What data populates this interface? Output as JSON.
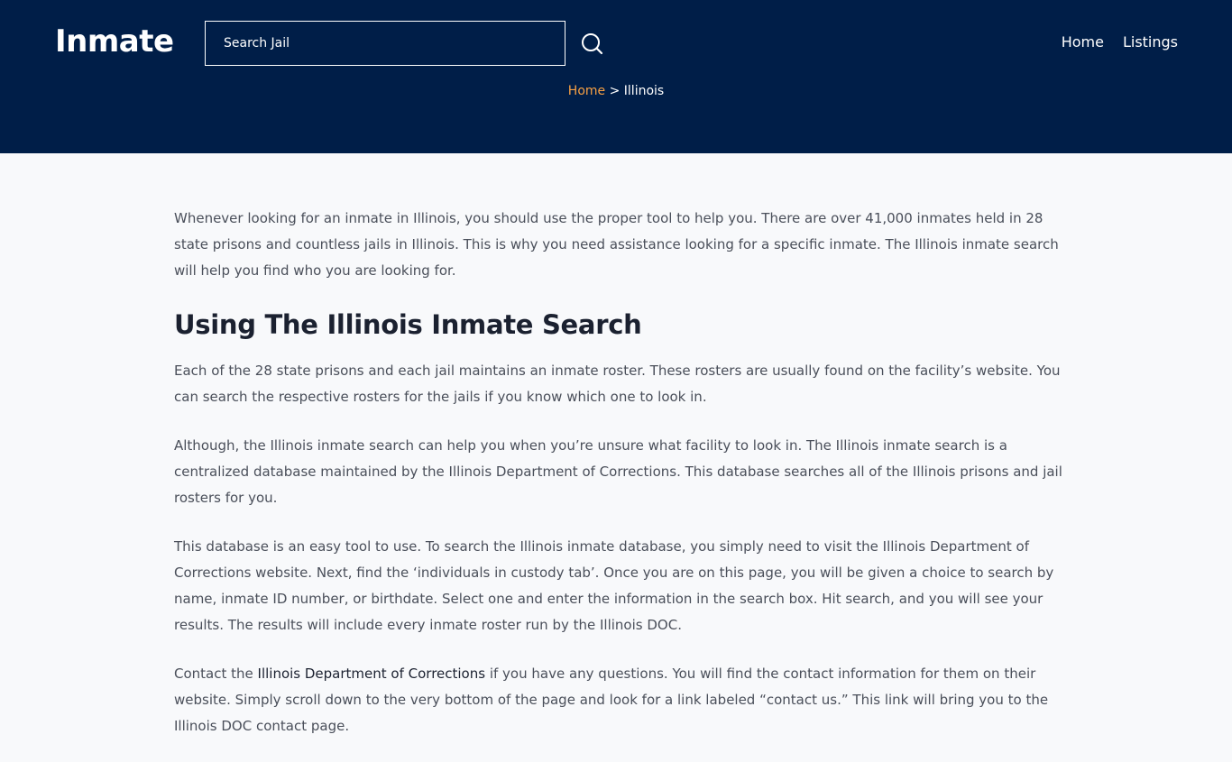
{
  "header": {
    "logo": "Inmate",
    "search": {
      "placeholder": "Search Jail",
      "value": ""
    },
    "nav": [
      {
        "label": "Home"
      },
      {
        "label": "Listings"
      }
    ]
  },
  "breadcrumb": {
    "home": "Home",
    "separator": " > ",
    "current": "Illinois"
  },
  "article": {
    "intro": "Whenever looking for an inmate in Illinois, you should use the proper tool to help you. There are over 41,000 inmates held in 28 state prisons and countless jails in Illinois. This is why you need assistance looking for a specific inmate. The Illinois inmate search will help you find who you are looking for.",
    "heading": "Using The Illinois Inmate Search",
    "p1": "Each of the 28 state prisons and each jail maintains an inmate roster. These rosters are usually found on the facility’s website. You can search the respective rosters for the jails if you know which one to look in.",
    "p2": "Although, the Illinois inmate search can help you when you’re unsure what facility to look in. The Illinois inmate search is a centralized database maintained by the Illinois Department of Corrections. This database searches all of the Illinois prisons and jail rosters for you.",
    "p3": "This database is an easy tool to use. To search the Illinois inmate database, you simply need to visit the Illinois Department of Corrections website. Next, find the ‘individuals in custody tab’. Once you are on this page, you will be given a choice to search by name, inmate ID number, or birthdate. Select one and enter the information in the search box. Hit search, and you will see your results. The results will include every inmate roster run by the Illinois DOC.",
    "p4_before": "Contact the ",
    "p4_link": "Illinois Department of Corrections",
    "p4_after": " if you have any questions. You will find the contact information for them on their website. Simply scroll down to the very bottom of the page and look for a link labeled “contact us.” This link will bring you to the Illinois DOC contact page."
  },
  "colors": {
    "header_bg": "#001e48",
    "accent": "#f6a044",
    "page_bg": "#f8f9fb"
  }
}
